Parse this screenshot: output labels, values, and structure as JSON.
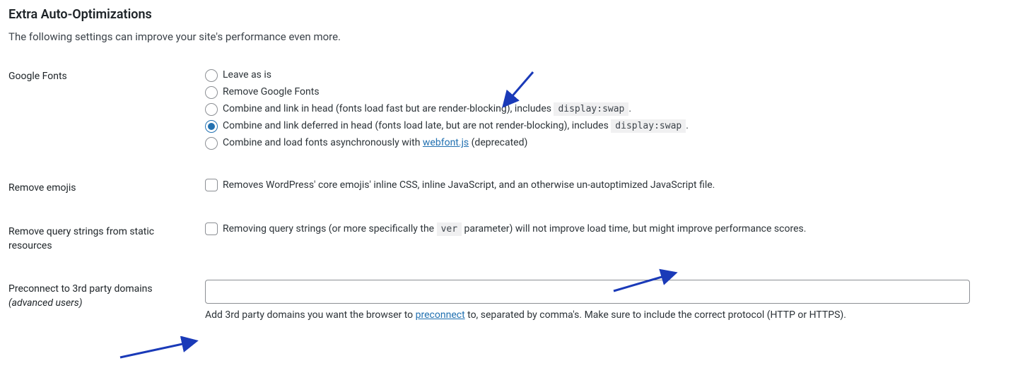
{
  "section": {
    "title": "Extra Auto-Optimizations",
    "description": "The following settings can improve your site's performance even more."
  },
  "google_fonts": {
    "label": "Google Fonts",
    "options": {
      "leave": "Leave as is",
      "remove": "Remove Google Fonts",
      "combine_head_a": "Combine and link in head (fonts load fast but are render-blocking), includes ",
      "combine_head_code": "display:swap",
      "combine_head_b": ".",
      "combine_deferred_a": "Combine and link deferred in head (fonts load late, but are not render-blocking), includes ",
      "combine_deferred_code": "display:swap",
      "combine_deferred_b": ".",
      "async_a": "Combine and load fonts asynchronously with ",
      "async_link": "webfont.js",
      "async_b": " (deprecated)"
    }
  },
  "remove_emojis": {
    "label": "Remove emojis",
    "desc": "Removes WordPress' core emojis' inline CSS, inline JavaScript, and an otherwise un-autoptimized JavaScript file."
  },
  "remove_query": {
    "label": "Remove query strings from static resources",
    "desc_a": "Removing query strings (or more specifically the ",
    "desc_code": "ver",
    "desc_b": " parameter) will not improve load time, but might improve performance scores."
  },
  "preconnect": {
    "label_a": "Preconnect to 3rd party domains ",
    "label_b": "(advanced users)",
    "value": "",
    "helper_a": "Add 3rd party domains you want the browser to ",
    "helper_link": "preconnect",
    "helper_b": " to, separated by comma's. Make sure to include the correct protocol (HTTP or HTTPS)."
  }
}
